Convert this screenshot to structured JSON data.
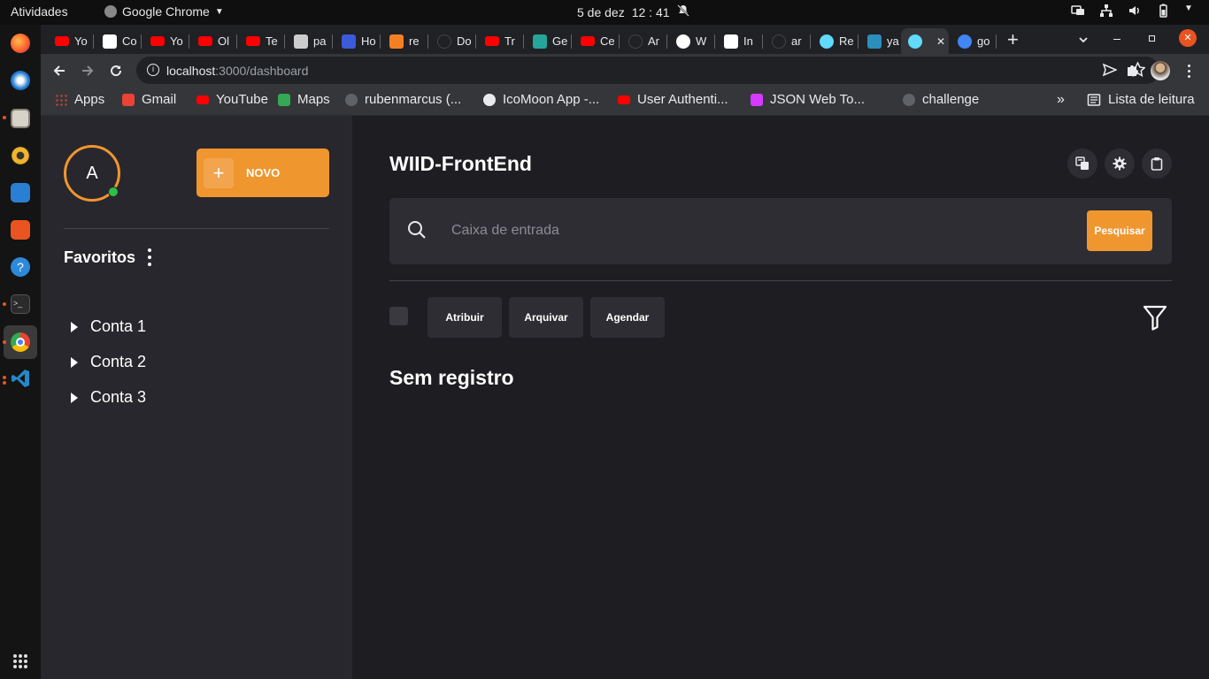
{
  "os": {
    "activities": "Atividades",
    "app_name": "Google Chrome",
    "clock_date": "5 de dez",
    "clock_time": "12 : 41"
  },
  "browser": {
    "tabs": [
      {
        "label": "Yo",
        "icon": "youtube-icon",
        "color": "#ff0000"
      },
      {
        "label": "Co",
        "icon": "medium-icon",
        "color": "#ffffff"
      },
      {
        "label": "Yo",
        "icon": "youtube-icon",
        "color": "#ff0000"
      },
      {
        "label": "Ol",
        "icon": "youtube-icon",
        "color": "#ff0000"
      },
      {
        "label": "Te",
        "icon": "youtube-icon",
        "color": "#ff0000"
      },
      {
        "label": "pa",
        "icon": "package-icon",
        "color": "#cccccc"
      },
      {
        "label": "Ho",
        "icon": "js-icon",
        "color": "#3b5bdb"
      },
      {
        "label": "re",
        "icon": "stackoverflow-icon",
        "color": "#f48024"
      },
      {
        "label": "Do",
        "icon": "github-icon",
        "color": "#202124"
      },
      {
        "label": "Tr",
        "icon": "youtube-icon",
        "color": "#ff0000"
      },
      {
        "label": "Ge",
        "icon": "flask-icon",
        "color": "#26a69a"
      },
      {
        "label": "Ce",
        "icon": "youtube-icon",
        "color": "#ff0000"
      },
      {
        "label": "Ar",
        "icon": "github-icon",
        "color": "#202124"
      },
      {
        "label": "W",
        "icon": "globe-icon",
        "color": "#ffffff"
      },
      {
        "label": "In",
        "icon": "dev-icon",
        "color": "#ffffff"
      },
      {
        "label": "ar",
        "icon": "github-icon",
        "color": "#202124"
      },
      {
        "label": "Re",
        "icon": "react-icon",
        "color": "#61dafb"
      },
      {
        "label": "ya",
        "icon": "yarn-icon",
        "color": "#2c8ebb"
      },
      {
        "label": "",
        "icon": "react-icon",
        "color": "#61dafb",
        "active": true
      },
      {
        "label": "go",
        "icon": "google-icon",
        "color": "#4285f4"
      }
    ],
    "url_host": "localhost",
    "url_path": ":3000/dashboard",
    "bookmarks": [
      {
        "label": "Apps",
        "icon": "apps-grid-icon",
        "color": "#e8eaed"
      },
      {
        "label": "Gmail",
        "icon": "gmail-icon",
        "color": "#ea4335"
      },
      {
        "label": "YouTube",
        "icon": "youtube-icon",
        "color": "#ff0000"
      },
      {
        "label": "Maps",
        "icon": "maps-icon",
        "color": "#34a853"
      },
      {
        "label": "rubenmarcus (...",
        "icon": "github-icon",
        "color": "#5f6368"
      },
      {
        "label": "IcoMoon App -...",
        "icon": "icomoon-icon",
        "color": "#e8eaed"
      },
      {
        "label": "User Authenti...",
        "icon": "youtube-icon",
        "color": "#ff0000"
      },
      {
        "label": "JSON Web To...",
        "icon": "jwt-icon",
        "color": "#d63aff"
      },
      {
        "label": "challenge",
        "icon": "github-icon",
        "color": "#5f6368"
      }
    ],
    "reading_list": "Lista de leitura"
  },
  "sidebar": {
    "avatar_letter": "A",
    "new_button": "NOVO",
    "favorites_title": "Favoritos",
    "accounts": [
      "Conta 1",
      "Conta 2",
      "Conta 3"
    ]
  },
  "main": {
    "title": "WIID-FrontEnd",
    "search_placeholder": "Caixa de entrada",
    "search_button": "Pesquisar",
    "actions": [
      "Atribuir",
      "Arquivar",
      "Agendar"
    ],
    "empty_message": "Sem registro"
  },
  "colors": {
    "accent": "#f0962f",
    "sidebar_bg": "#28272d",
    "main_bg": "#1e1d22",
    "online": "#2cbf46"
  }
}
